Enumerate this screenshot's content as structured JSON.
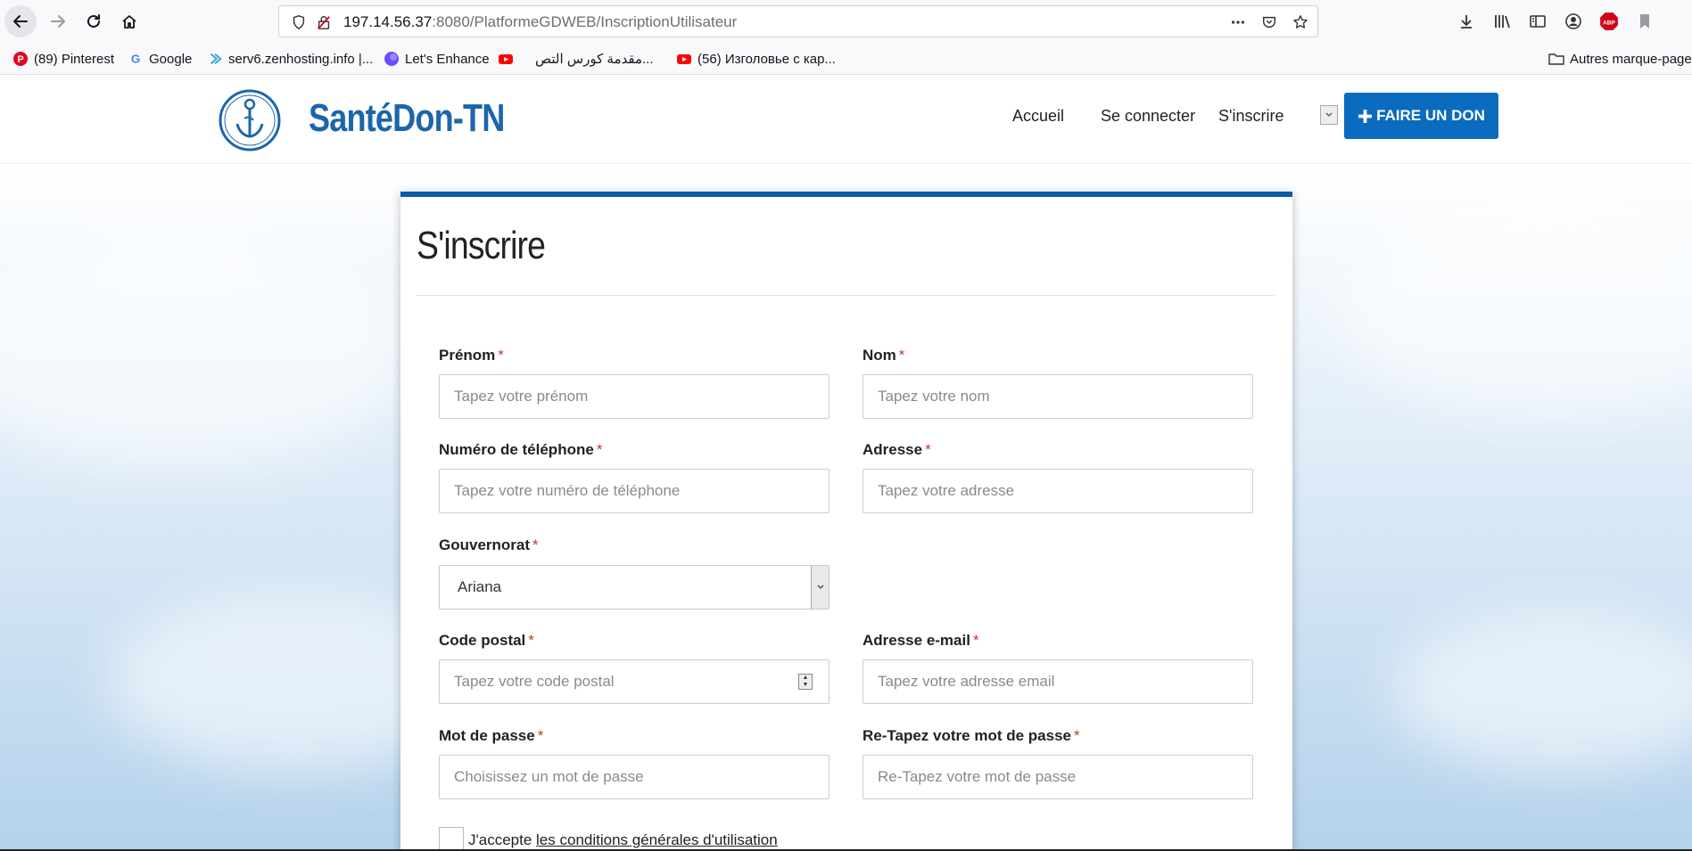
{
  "browser": {
    "url_host": "197.14.56.37",
    "url_rest": ":8080/PlatformeGDWEB/InscriptionUtilisateur",
    "bookmarks": [
      {
        "label": "(89) Pinterest",
        "icon": "pinterest-icon",
        "color": "#e60023"
      },
      {
        "label": "Google",
        "icon": "google-icon",
        "color": "#4285f4"
      },
      {
        "label": "serv6.zenhosting.info |...",
        "icon": "arrow-icon",
        "color": "#2a9bd8"
      },
      {
        "label": "Let's Enhance",
        "icon": "enhance-icon",
        "color": "#6c4df6"
      },
      {
        "label": "مقدمة كورس التص...",
        "icon": "youtube-icon",
        "color": "#ff0000"
      },
      {
        "label": "(56) Изголовье с кар...",
        "icon": "youtube-icon",
        "color": "#ff0000"
      }
    ],
    "other_bookmarks": "Autres marque-pages"
  },
  "header": {
    "brand": "SantéDon-TN",
    "nav": [
      "Accueil",
      "Se connecter",
      "S'inscrire"
    ],
    "cta": "FAIRE UN DON",
    "brand_color": "#1b66ab",
    "cta_color": "#0b6bbf"
  },
  "form": {
    "title": "S'inscrire",
    "required_mark": "*",
    "fields": {
      "prenom": {
        "label": "Prénom",
        "placeholder": "Tapez votre prénom"
      },
      "nom": {
        "label": "Nom",
        "placeholder": "Tapez votre nom"
      },
      "telephone": {
        "label": "Numéro de téléphone",
        "placeholder": "Tapez votre numéro de téléphone"
      },
      "adresse": {
        "label": "Adresse",
        "placeholder": "Tapez votre adresse"
      },
      "gouvernorat": {
        "label": "Gouvernorat",
        "value": "Ariana"
      },
      "code_postal": {
        "label": "Code postal",
        "placeholder": "Tapez votre code postal"
      },
      "email": {
        "label": "Adresse e-mail",
        "placeholder": "Tapez votre adresse email"
      },
      "password": {
        "label": "Mot de passe",
        "placeholder": "Choisissez un mot de passe"
      },
      "password_confirm": {
        "label": "Re-Tapez votre mot de passe",
        "placeholder": "Re-Tapez votre mot de passe"
      }
    },
    "terms_prefix": "J'accepte",
    "terms_link": "les conditions générales d'utilisation"
  }
}
